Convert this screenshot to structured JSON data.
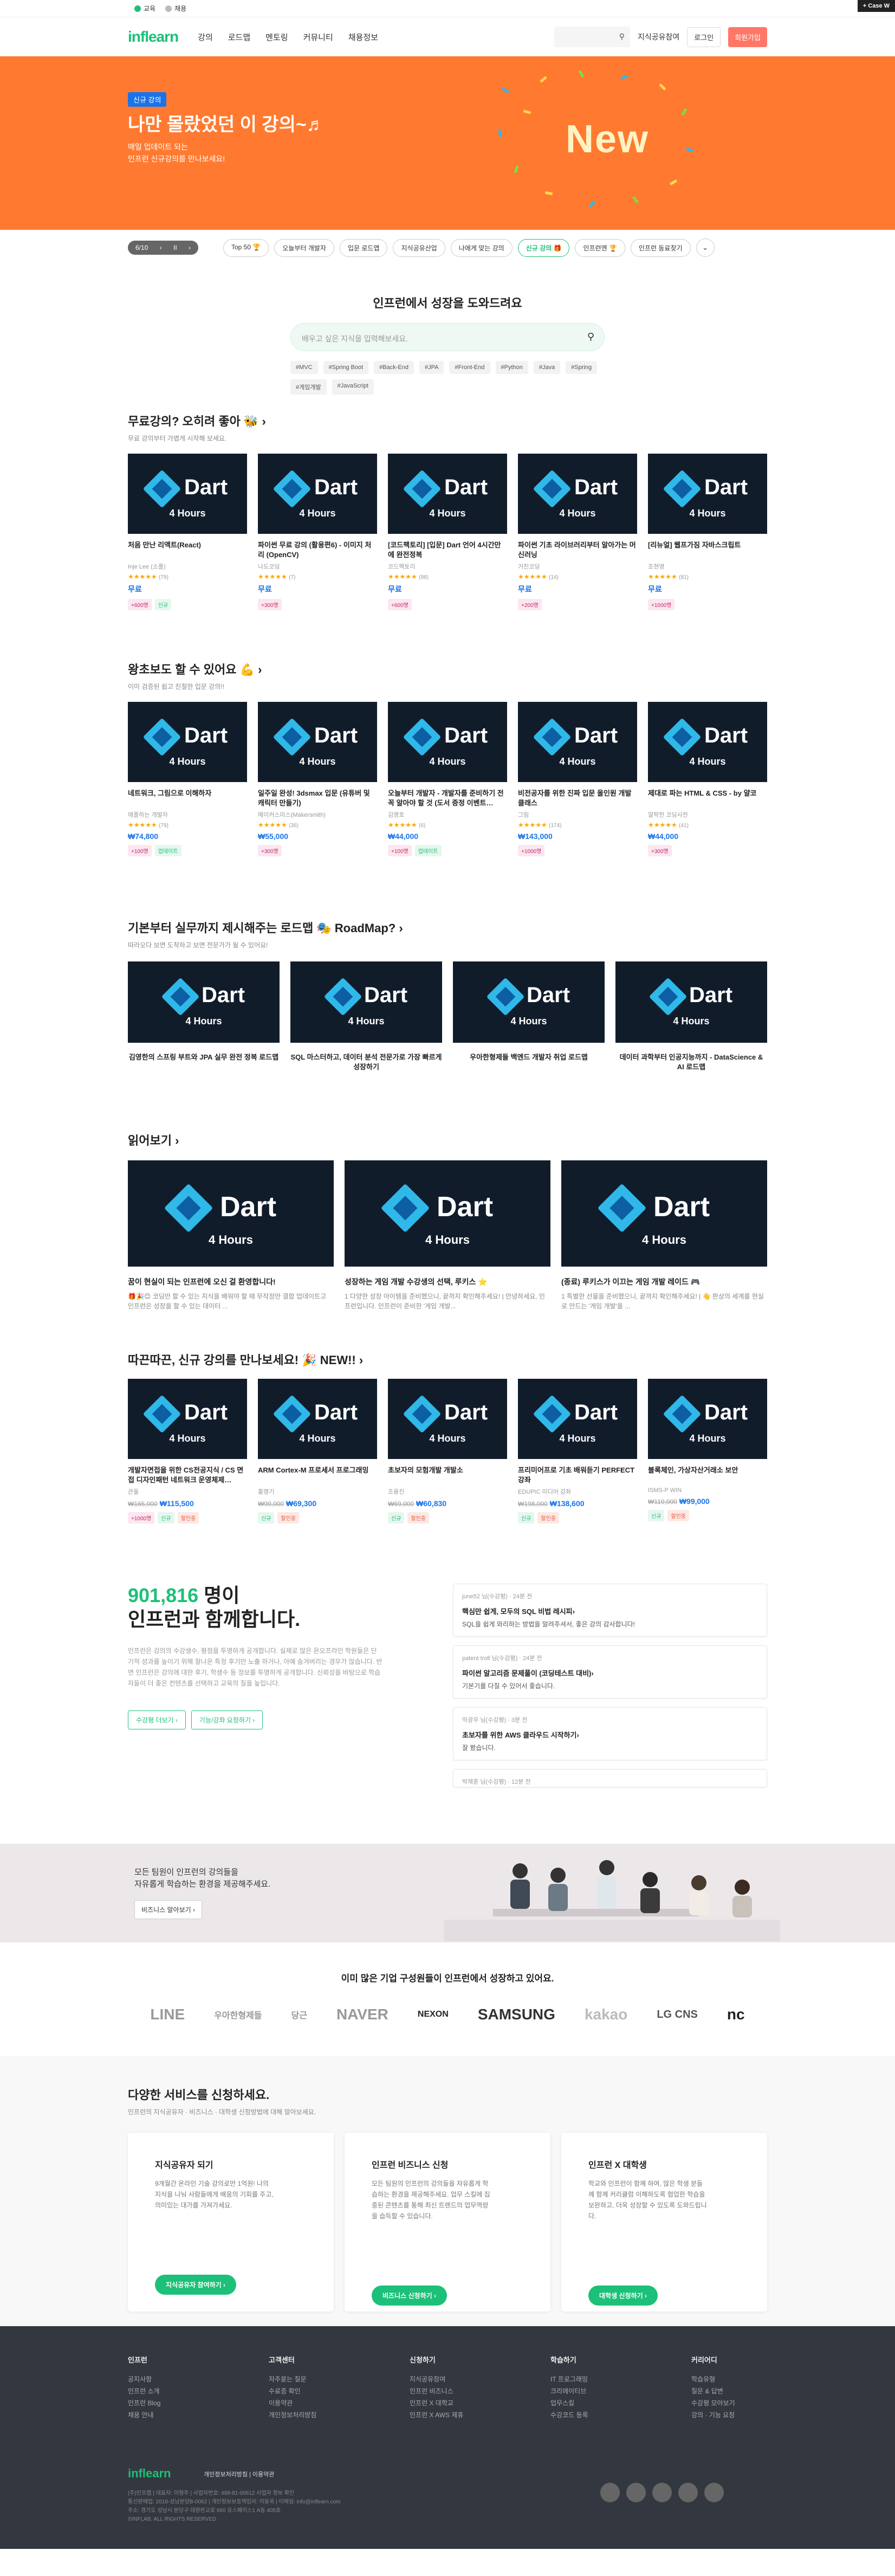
{
  "topbar": {
    "tabs": [
      {
        "label": "교육"
      },
      {
        "label": "채용"
      }
    ],
    "case_label": "+ Case W"
  },
  "nav": {
    "logo": "inflearn",
    "menu": [
      "강의",
      "로드맵",
      "멘토링",
      "커뮤니티",
      "채용정보"
    ],
    "share_label": "지식공유참여",
    "login_label": "로그인",
    "join_label": "회원가입"
  },
  "hero": {
    "badge": "신규 강의",
    "title": "나만 몰랐었던 이 강의~♬",
    "desc_line1": "매일 업데이트 되는",
    "desc_line2": "인프런 신규강의를 만나보세요!",
    "art_text": "New",
    "bg_color": "#ff7a30"
  },
  "pager": {
    "text": "6/10",
    "prev": "‹",
    "pause": "II",
    "next": "›"
  },
  "chips": [
    "Top 50 🏆",
    "오늘부터 개발자",
    "입문 로드맵",
    "지식공유산업",
    "나에게 맞는 강의",
    "신규 강의 🎁",
    "인프런엔 🏆",
    "인프런 동료찾기"
  ],
  "search_section": {
    "title": "인프런에서 성장을 도와드려요",
    "placeholder": "배우고 싶은 지식을 입력해보세요.",
    "tags": [
      "#MVC",
      "#Spring Boot",
      "#Back-End",
      "#JPA",
      "#Front-End",
      "#Python",
      "#Java",
      "#Spring",
      "#게임개발",
      "#JavaScript"
    ]
  },
  "free_section": {
    "title": "무료강의? 오히려 좋아 🐝 ›",
    "sub": "무료 강의부터 가볍게 시작해 보세요.",
    "courses": [
      {
        "title": "처음 만난 리액트(React)",
        "inst": "Inje Lee (소플)",
        "stars": "★★★★★",
        "rating": "(79)",
        "price": "무료",
        "old": "",
        "badges": [
          "+600명",
          "신규"
        ]
      },
      {
        "title": "파이썬 무료 강의 (활용편6) - 이미지 처리 (OpenCV)",
        "inst": "나도코딩",
        "stars": "★★★★★",
        "rating": "(7)",
        "price": "무료",
        "old": "",
        "badges": [
          "+300명"
        ]
      },
      {
        "title": "[코드팩토리] [입문] Dart 언어 4시간만에 완전정복",
        "inst": "코드팩토리",
        "stars": "★★★★★",
        "rating": "(98)",
        "price": "무료",
        "old": "",
        "badges": [
          "+600명"
        ]
      },
      {
        "title": "파이썬 기초 라이브러리부터 알아가는 머신러닝",
        "inst": "거친코딩",
        "stars": "★★★★★",
        "rating": "(14)",
        "price": "무료",
        "old": "",
        "badges": [
          "+200명"
        ]
      },
      {
        "title": "[리뉴얼] 웹프가짐 자바스크립트",
        "inst": "조현영",
        "stars": "★★★★★",
        "rating": "(81)",
        "price": "무료",
        "old": "",
        "badges": [
          "+1000명"
        ]
      }
    ]
  },
  "beginner_section": {
    "title": "왕초보도 할 수 있어요 💪 ›",
    "sub": "이미 검증된 쉽고 친절한 입문 강의!!",
    "courses": [
      {
        "title": "네트워크, 그림으로 이해하자",
        "inst": "애플하는 개발자",
        "stars": "★★★★★",
        "rating": "(79)",
        "price": "₩74,800",
        "old": "",
        "badges": [
          "+100명",
          "업데이트"
        ]
      },
      {
        "title": "일주일 완성! 3dsmax 입문 (유튜버 및 캐릭터 만들기)",
        "inst": "메이커스미스(Makersmith)",
        "stars": "★★★★★",
        "rating": "(36)",
        "price": "₩55,000",
        "old": "",
        "badges": [
          "+300명"
        ]
      },
      {
        "title": "오늘부터 개발자 - 개발자를 준비하기 전 꼭 알아야 할 것 (도서 증정 이벤트…",
        "inst": "김명호",
        "stars": "★★★★★",
        "rating": "(6)",
        "price": "₩44,000",
        "old": "",
        "badges": [
          "+100명",
          "업데이트"
        ]
      },
      {
        "title": "비전공자를 위한 진짜 입문 올인원 개발 클래스",
        "inst": "그림",
        "stars": "★★★★★",
        "rating": "(174)",
        "price": "₩143,000",
        "old": "",
        "badges": [
          "+1000명"
        ]
      },
      {
        "title": "제대로 파는 HTML & CSS - by 얄코",
        "inst": "얄팍한 코딩사전",
        "stars": "★★★★★",
        "rating": "(41)",
        "price": "₩44,000",
        "old": "",
        "badges": [
          "+300명"
        ]
      }
    ]
  },
  "roadmap_section": {
    "title": "기본부터 실무까지 제시해주는 로드맵 🎭 RoadMap? ›",
    "sub": "따라오다 보면 도착하고 보면 전문가가 될 수 있어요!",
    "items": [
      {
        "title": "김영한의 스프링 부트와 JPA 실무 완전 정복 로드맵"
      },
      {
        "title": "SQL 마스터하고, 데이터 분석 전문가로 가장 빠르게 성장하기"
      },
      {
        "title": "우아한형제들 백엔드 개발자 취업 로드맵"
      },
      {
        "title": "데이터 과학부터 인공지능까지 - DataScience & AI 로드맵"
      }
    ]
  },
  "reading_section": {
    "title": "읽어보기 ›",
    "items": [
      {
        "title": "꿈이 현실이 되는 인프런에 오신 걸 환영합니다!",
        "desc": "🎁🎉😊 코딩만 할 수 있는 지식을 배워야 할 때 무작정만 결합 업데이트고 인프런은 성장을 할 수 있는 데이터 ..."
      },
      {
        "title": "성장하는 게임 개발 수강생의 선택, 루키스 ⭐",
        "desc": "1 다양한 성장 아이템을 준비했으니, 끝까지 확인해주세요! | 안녕하세요, 인프런입니다. 인프런이 준비한 '게임 개발..."
      },
      {
        "title": "(종료) 루키스가 이끄는 게임 개발 레이드 🎮",
        "desc": "1 특별한 선물을 준비했으니, 끝까지 확인해주세요! | 👋 판상의 세계를 현실로 만드는 '게임 개발'을 ..."
      }
    ]
  },
  "new_section": {
    "title": "따끈따끈, 신규 강의를 만나보세요! 🎉 NEW!! ›",
    "courses": [
      {
        "title": "개발자면접을 위한 CS전공지식 / CS 면접 디자인패턴 네트워크 운영체제…",
        "inst": "큰돌",
        "stars": "",
        "rating": "",
        "price": "₩115,500",
        "old": "₩165,000",
        "badges": [
          "+1000명",
          "신규",
          "할인중"
        ]
      },
      {
        "title": "ARM Cortex-M 프로세서 프로그래밍",
        "inst": "홍명기",
        "stars": "",
        "rating": "",
        "price": "₩69,300",
        "old": "₩99,000",
        "badges": [
          "신규",
          "할인중"
        ]
      },
      {
        "title": "초보자의 모험개발 개발소",
        "inst": "조용진",
        "stars": "",
        "rating": "",
        "price": "₩60,830",
        "old": "₩69,000",
        "badges": [
          "신규",
          "할인중"
        ]
      },
      {
        "title": "프리미어프로 기초 배워듣기 PERFECT 강좌",
        "inst": "EDUPIC 미디어 강좌",
        "stars": "",
        "rating": "",
        "price": "₩138,600",
        "old": "₩198,000",
        "badges": [
          "신규",
          "할인중"
        ]
      },
      {
        "title": "블록체인, 가상자산거래소 보안",
        "inst": "ISMS-P WIN",
        "stars": "",
        "rating": "",
        "price": "₩99,000",
        "old": "₩110,000",
        "badges": [
          "신규",
          "할인중"
        ]
      }
    ]
  },
  "stats": {
    "count": "901,816",
    "count_suffix": " 명이",
    "line2": "인프런과 함께합니다.",
    "desc": "인프런은 강의의 수강생수, 평점을 투명하게 공개합니다. 실제로 많은 온오프라인 학원들은 단기적 성과를 높이기 위해 잘나온 특정 후기만 노출 하거나, 아예 숨겨버리는 경우가 많습니다. 반면 인프런은 강의에 대한 후기, 학생수 등 정보를 투명하게 공개합니다. 신뢰성을 바탕으로 학습자들이 더 좋은 컨텐츠를 선택하고 교육의 질을 높입니다.",
    "btn1": "수강평 더보기 ›",
    "btn2": "기능/강좌 요청하기 ›",
    "reviews": [
      {
        "who": "june52 님(수강평) · 24분 전",
        "q": "핵심만 쉽게, 모두의 SQL 비법 레시피›",
        "a": "SQL을 쉽게 와리하는 방법을 알려주셔서, 좋은 강의 감사합니다!"
      },
      {
        "who": "patent troll 님(수강평) · 24분 전",
        "q": "파이썬 알고리즘 문제풀이 (코딩테스트 대비)›",
        "a": "기본기를 다질 수 있어서 좋습니다."
      },
      {
        "who": "막광우 님(수강평) · 3분 전",
        "q": "초보자를 위한 AWS 클라우드 시작하기›",
        "a": "잘 봤습니다."
      },
      {
        "who": "박재훈 님(수강평) · 12분 전",
        "q": "",
        "a": ""
      }
    ]
  },
  "band": {
    "line1": "모든 팀원이 인프런의 강의들을",
    "line2": "자유롭게 학습하는 환경을 제공해주세요.",
    "btn": "비즈니스 알아보기 ›"
  },
  "companies": {
    "title": "이미 많은 기업 구성원들이 인프런에서 성장하고 있어요.",
    "logos": [
      "LINE",
      "우아한형제들",
      "당근",
      "NAVER",
      "NEXON",
      "SAMSUNG",
      "kakao",
      "LG CNS",
      "nc"
    ]
  },
  "services": {
    "title": "다양한 서비스를 신청하세요.",
    "sub": "인프런의 지식공유자 · 비즈니스 · 대학생 신청방법에 대해 알아보세요.",
    "cards": [
      {
        "title": "지식공유자 되기",
        "desc": "9개월간 온라인 기술 강의로만 1억원! 나의 지식을 나눠 사람들에게 배움의 기회를 주고, 의미있는 대가를 가져가세요.",
        "btn": "지식공유자 참여하기 ›"
      },
      {
        "title": "인프런 비즈니스 신청",
        "desc": "모든 팀원의 인프런의 강의들을 자유롭게 학습하는 환경을 제공해주세요. 업무 스킬에 집중된 콘텐츠를 통해 최신 트렌드의 업무역량을 습득할 수 있습니다.",
        "btn": "비즈니스 신청하기 ›"
      },
      {
        "title": "인프런 X 대학생",
        "desc": "학교와 인프런이 함께 하여, 많은 학생 분들께 함께 커리큘럼 이해하도록 협업한 학습을 보완하고, 더욱 성장할 수 있도록 도와드립니다.",
        "btn": "대학생 신청하기 ›"
      }
    ]
  },
  "footer": {
    "cols": [
      {
        "title": "인프런",
        "items": [
          "공지사항",
          "인프런 소개",
          "인프런 Blog",
          "채용 안내"
        ]
      },
      {
        "title": "고객센터",
        "items": [
          "자주묻는 질문",
          "수료증 확인",
          "이용약관",
          "개인정보처리방침"
        ]
      },
      {
        "title": "신청하기",
        "items": [
          "지식공유참여",
          "인프런 비즈니스",
          "인프런 X 대학교",
          "인프런 X AWS 제휴"
        ]
      },
      {
        "title": "학습하기",
        "items": [
          "IT 프로그래밍",
          "크리에이티브",
          "업무스킬",
          "수강코드 등록"
        ]
      },
      {
        "title": "커리어디",
        "items": [
          "학습유형",
          "질문 & 답변",
          "수강평 모아보기",
          "강의 · 기능 요청"
        ]
      }
    ],
    "logo": "inflearn",
    "links": "개인정보처리방침 | 이용약관",
    "info1": "(주)인프랩 | 대표자: 이형주 | 사업자번호: 499-81-00612 사업자 정보 확인",
    "info2": "통신판매업: 2018-성남분당B-0062 | 개인정보보호책임자: 이동욱 | 이메일: info@inflearn.com",
    "info3": "주소: 경기도 성남시 분당구 대왕판교로 660 유스페이스1 A동 405호",
    "copyright": "©INFLAB. ALL RIGHTS RESERVED"
  }
}
